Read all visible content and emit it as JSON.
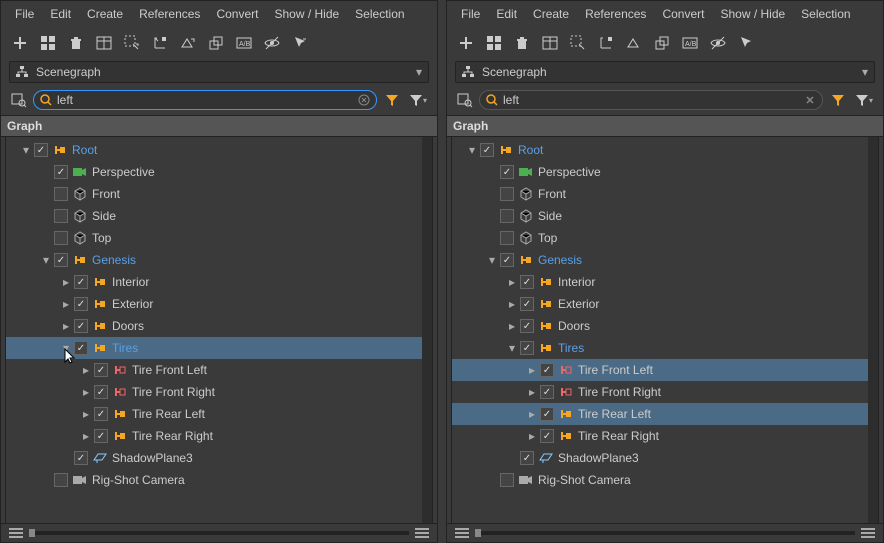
{
  "menus": [
    "File",
    "Edit",
    "Create",
    "References",
    "Convert",
    "Show / Hide",
    "Selection"
  ],
  "scenegraph_label": "Scenegraph",
  "search": {
    "left_value": "left",
    "right_value": "left"
  },
  "tree_header": "Graph",
  "nodes": {
    "root": "Root",
    "perspective": "Perspective",
    "front": "Front",
    "side": "Side",
    "top": "Top",
    "genesis": "Genesis",
    "interior": "Interior",
    "exterior": "Exterior",
    "doors": "Doors",
    "tires": "Tires",
    "tfl": "Tire Front Left",
    "tfr": "Tire Front Right",
    "trl": "Tire Rear Left",
    "trr": "Tire Rear Right",
    "shadow": "ShadowPlane3",
    "rig": "Rig-Shot Camera"
  }
}
